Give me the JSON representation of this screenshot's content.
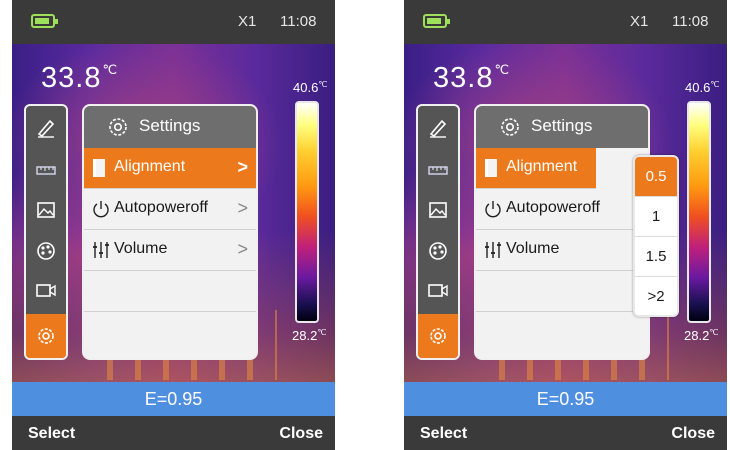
{
  "status": {
    "zoom": "X1",
    "time": "11:08"
  },
  "thermal": {
    "center_temp": "33.8",
    "center_unit": "℃",
    "max_temp": "40.6",
    "min_temp": "28.2",
    "unit": "℃"
  },
  "sidebar": {
    "icons": [
      "pen-icon",
      "ruler-icon",
      "image-icon",
      "palette-icon",
      "video-icon",
      "gear-icon"
    ],
    "selected_index": 5
  },
  "settings": {
    "title": "Settings",
    "items": [
      {
        "label": "Alignment",
        "icon": "alignment-icon"
      },
      {
        "label": "Autopoweroff",
        "icon": "power-icon"
      },
      {
        "label": "Volume",
        "icon": "volume-sliders-icon"
      }
    ],
    "selected_index": 0
  },
  "alignment_options": [
    "0.5",
    "1",
    "1.5",
    ">2"
  ],
  "alignment_selected_index": 0,
  "emissivity": "E=0.95",
  "softkeys": {
    "left": "Select",
    "right": "Close"
  },
  "colors": {
    "accent": "#ec7a1c",
    "emissivity_bar": "#4f8fe0",
    "battery": "#9ee05a"
  }
}
